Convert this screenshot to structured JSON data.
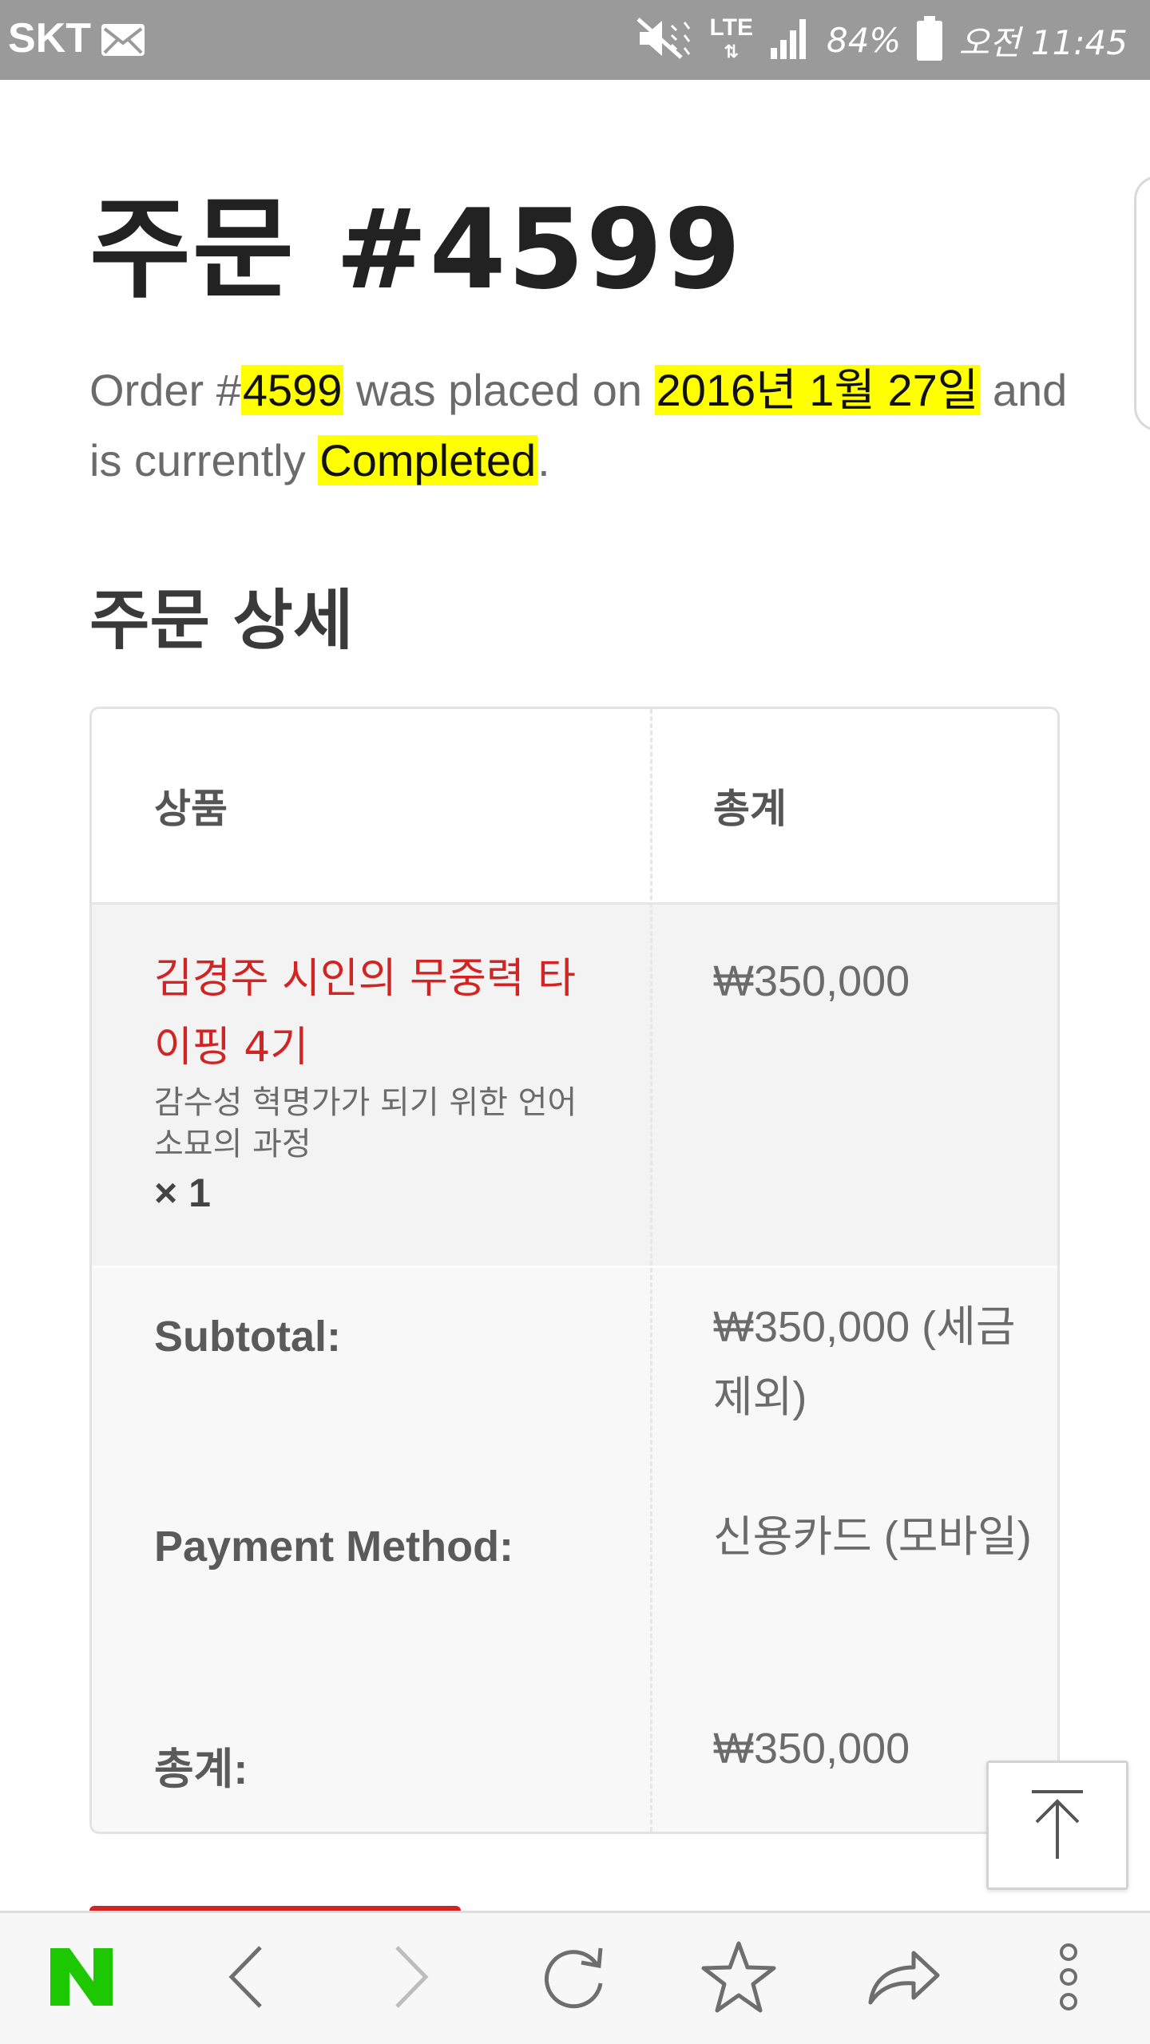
{
  "status_bar": {
    "carrier": "SKT",
    "network": "LTE",
    "battery": "84%",
    "time": "오전 11:45",
    "icons": [
      "mail-icon",
      "mute-icon",
      "lte-data-icon",
      "signal-icon",
      "battery-icon"
    ]
  },
  "order": {
    "title": "주문 #4599",
    "note": {
      "prefix": "Order #",
      "number": "4599",
      "mid": " was placed on ",
      "date": "2016년 1월 27일",
      "and": " and is currently ",
      "status": "Completed",
      "end": "."
    }
  },
  "details": {
    "title": "주문 상세",
    "header": {
      "product": "상품",
      "total": "총계"
    },
    "item": {
      "name": "김경주 시인의 무중력 타이핑 4기",
      "meta": "감수성 혁명가가 되기 위한 언어 소묘의 과정",
      "qty": "× 1",
      "price": "₩350,000"
    },
    "summary": [
      {
        "label": "Subtotal:",
        "value": "₩350,000 (세금 제외)"
      },
      {
        "label": "Payment Method:",
        "value": "신용카드 (모바일)"
      },
      {
        "label": "총계:",
        "value": "₩350,000"
      }
    ]
  },
  "colors": {
    "highlight": "#ffff00",
    "product_link": "#d32424",
    "naver_green": "#1ec800",
    "status_bar": "#9a9a9a"
  },
  "browser_bar": {
    "buttons": [
      "naver-home-button",
      "back-button",
      "forward-button",
      "reload-button",
      "bookmark-button",
      "share-button",
      "menu-button"
    ]
  }
}
